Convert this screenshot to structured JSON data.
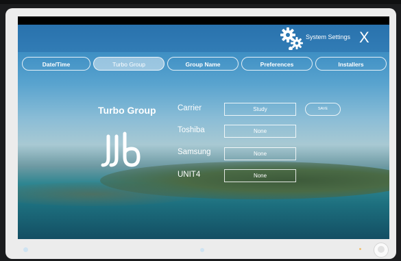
{
  "header": {
    "title": "System Settings",
    "icon": "gears-icon",
    "close_label": "X"
  },
  "tabs": [
    {
      "label": "Date/Time",
      "active": false
    },
    {
      "label": "Turbo Group",
      "active": true
    },
    {
      "label": "Group Name",
      "active": false
    },
    {
      "label": "Preferences",
      "active": false
    },
    {
      "label": "Installers",
      "active": false
    }
  ],
  "section": {
    "title": "Turbo Group",
    "logo": "turbo-group-logo"
  },
  "rows": [
    {
      "brand": "Carrier",
      "value": "Study"
    },
    {
      "brand": "Toshiba",
      "value": "None"
    },
    {
      "brand": "Samsung",
      "value": "None"
    },
    {
      "brand": "UNIT4",
      "value": "None"
    }
  ],
  "save_label": "SAVE",
  "colors": {
    "header": "#2b78b2",
    "accent": "#ffffff"
  }
}
